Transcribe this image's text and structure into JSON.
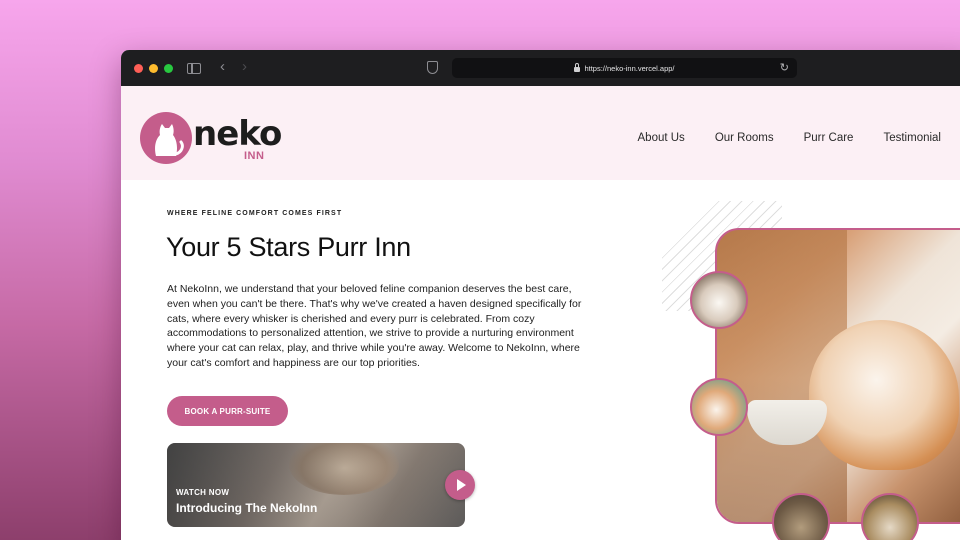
{
  "browser": {
    "url": "https://neko-inn.vercel.app/"
  },
  "brand": {
    "name": "neko",
    "sub": "INN",
    "accent_color": "#c45d8b"
  },
  "nav": {
    "items": [
      {
        "label": "About Us"
      },
      {
        "label": "Our Rooms"
      },
      {
        "label": "Purr Care"
      },
      {
        "label": "Testimonial"
      }
    ]
  },
  "hero": {
    "eyebrow": "WHERE FELINE COMFORT COMES FIRST",
    "title": "Your 5 Stars Purr Inn",
    "body": "At NekoInn, we understand that your beloved feline companion deserves the best care, even when you can't be there. That's why we've created a haven designed specifically for cats, where every whisker is cherished and every purr is celebrated. From cozy accommodations to personalized attention, we strive to provide a nurturing environment where your cat can relax, play, and thrive while you're away. Welcome to NekoInn, where your cat's comfort and happiness are our top priorities.",
    "cta_label": "BOOK A PURR-SUITE"
  },
  "video": {
    "kicker": "WATCH NOW",
    "title": "Introducing The NekoInn"
  },
  "icons": {
    "back": "chevron-left-icon",
    "forward": "chevron-right-icon",
    "reload": "reload-icon",
    "shield": "shield-icon",
    "lock": "lock-icon",
    "play": "play-icon"
  }
}
